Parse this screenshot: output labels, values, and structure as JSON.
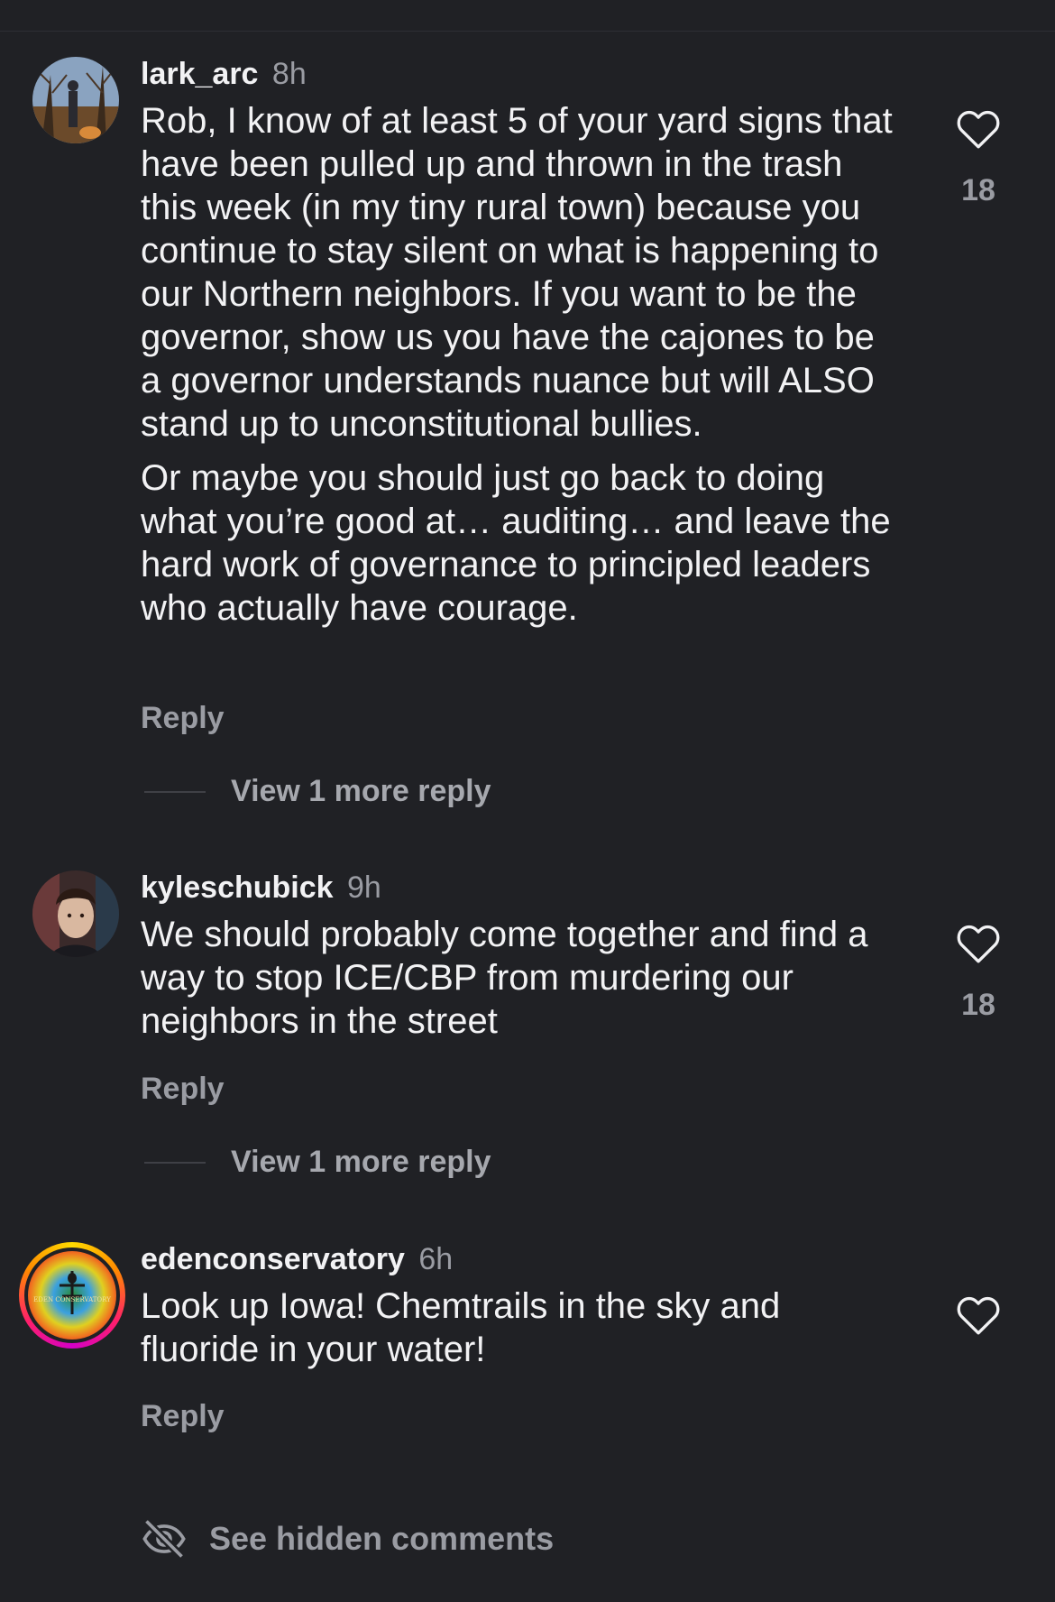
{
  "comments": [
    {
      "username": "lark_arc",
      "time": "8h",
      "paragraphs": [
        "Rob, I know of at least 5 of your yard signs that have been pulled up and thrown in the trash this week (in my tiny rural town) because you continue to stay silent on what is happening to our Northern neighbors. If you want to be the governor, show us you have the cajones to be a governor understands nuance but will ALSO stand up to unconstitutional bullies.",
        "Or maybe you should just go back to doing what you’re good at… auditing… and leave the hard work of governance to principled leaders who actually have courage."
      ],
      "likes": "18",
      "reply_label": "Reply",
      "view_more_label": "View 1 more reply"
    },
    {
      "username": "kyleschubick",
      "time": "9h",
      "paragraphs": [
        "We should probably come together and find a way to stop ICE/CBP from murdering our neighbors in the street"
      ],
      "likes": "18",
      "reply_label": "Reply",
      "view_more_label": "View 1 more reply"
    },
    {
      "username": "edenconservatory",
      "time": "6h",
      "avatar_text": "EDEN CONSERVATORY",
      "paragraphs": [
        "Look up Iowa! Chemtrails in the sky and fluoride in your water!"
      ],
      "reply_label": "Reply"
    }
  ],
  "footer": {
    "hidden_comments_label": "See hidden comments",
    "icon": "eye-slash-icon"
  },
  "colors": {
    "background": "#202125",
    "primary_text": "#f2f2f4",
    "secondary_text": "#9a9ca3"
  }
}
